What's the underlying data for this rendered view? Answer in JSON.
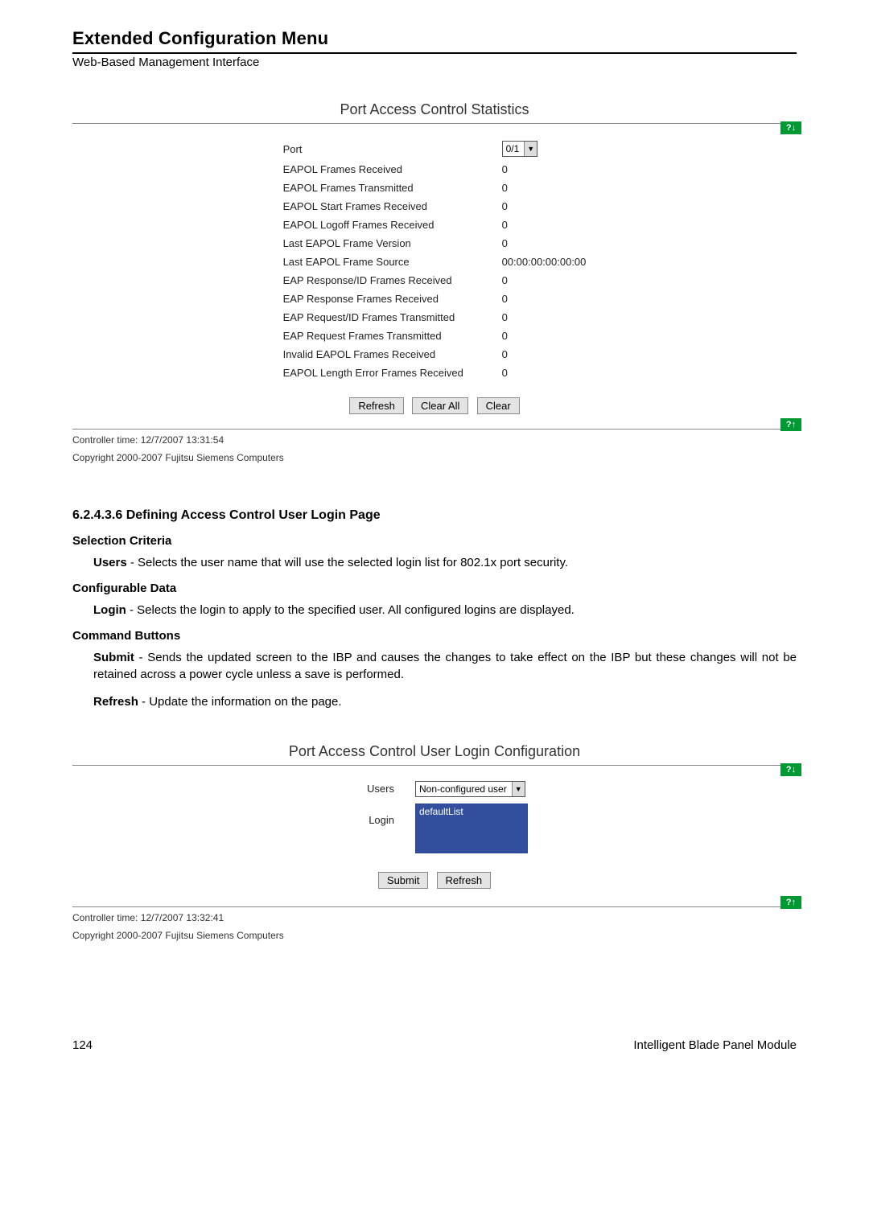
{
  "header": {
    "title": "Extended Configuration Menu",
    "subtitle": "Web-Based Management Interface"
  },
  "panel1": {
    "title": "Port Access Control Statistics",
    "helpTop": "?↓",
    "helpBottom": "?↑",
    "rows": {
      "port_label": "Port",
      "port_value": "0/1",
      "r1_label": "EAPOL Frames Received",
      "r1_value": "0",
      "r2_label": "EAPOL Frames Transmitted",
      "r2_value": "0",
      "r3_label": "EAPOL Start Frames Received",
      "r3_value": "0",
      "r4_label": "EAPOL Logoff Frames Received",
      "r4_value": "0",
      "r5_label": "Last EAPOL Frame Version",
      "r5_value": "0",
      "r6_label": "Last EAPOL Frame Source",
      "r6_value": "00:00:00:00:00:00",
      "r7_label": "EAP Response/ID Frames Received",
      "r7_value": "0",
      "r8_label": "EAP Response Frames Received",
      "r8_value": "0",
      "r9_label": "EAP Request/ID Frames Transmitted",
      "r9_value": "0",
      "r10_label": "EAP Request Frames Transmitted",
      "r10_value": "0",
      "r11_label": "Invalid EAPOL Frames Received",
      "r11_value": "0",
      "r12_label": "EAPOL Length Error Frames Received",
      "r12_value": "0"
    },
    "buttons": {
      "refresh": "Refresh",
      "clearall": "Clear All",
      "clear": "Clear"
    },
    "footer": {
      "time": "Controller time: 12/7/2007 13:31:54",
      "copyright": "Copyright 2000-2007 Fujitsu Siemens Computers"
    }
  },
  "doc": {
    "heading": "6.2.4.3.6    Defining Access Control User Login Page",
    "selcrit_h": "Selection Criteria",
    "selcrit_b_bold": "Users",
    "selcrit_b_rest": " - Selects the user name that will use the selected login list for 802.1x port security.",
    "confdata_h": "Configurable Data",
    "confdata_b_bold": "Login",
    "confdata_b_rest": " - Selects the login to apply to the specified user. All configured logins are displayed.",
    "cmdbtn_h": "Command Buttons",
    "cmd1_bold": "Submit",
    "cmd1_rest": " - Sends the updated screen to the IBP and causes the changes to take effect on the IBP but these changes will not be retained across a power cycle unless a save is performed.",
    "cmd2_bold": "Refresh",
    "cmd2_rest": " - Update the information on the page."
  },
  "panel2": {
    "title": "Port Access Control User Login Configuration",
    "helpTop": "?↓",
    "helpBottom": "?↑",
    "users_label": "Users",
    "users_value": "Non-configured user",
    "login_label": "Login",
    "login_option": "defaultList",
    "buttons": {
      "submit": "Submit",
      "refresh": "Refresh"
    },
    "footer": {
      "time": "Controller time: 12/7/2007 13:32:41",
      "copyright": "Copyright 2000-2007 Fujitsu Siemens Computers"
    }
  },
  "pagefoot": {
    "pagenum": "124",
    "book": "Intelligent Blade Panel Module"
  }
}
